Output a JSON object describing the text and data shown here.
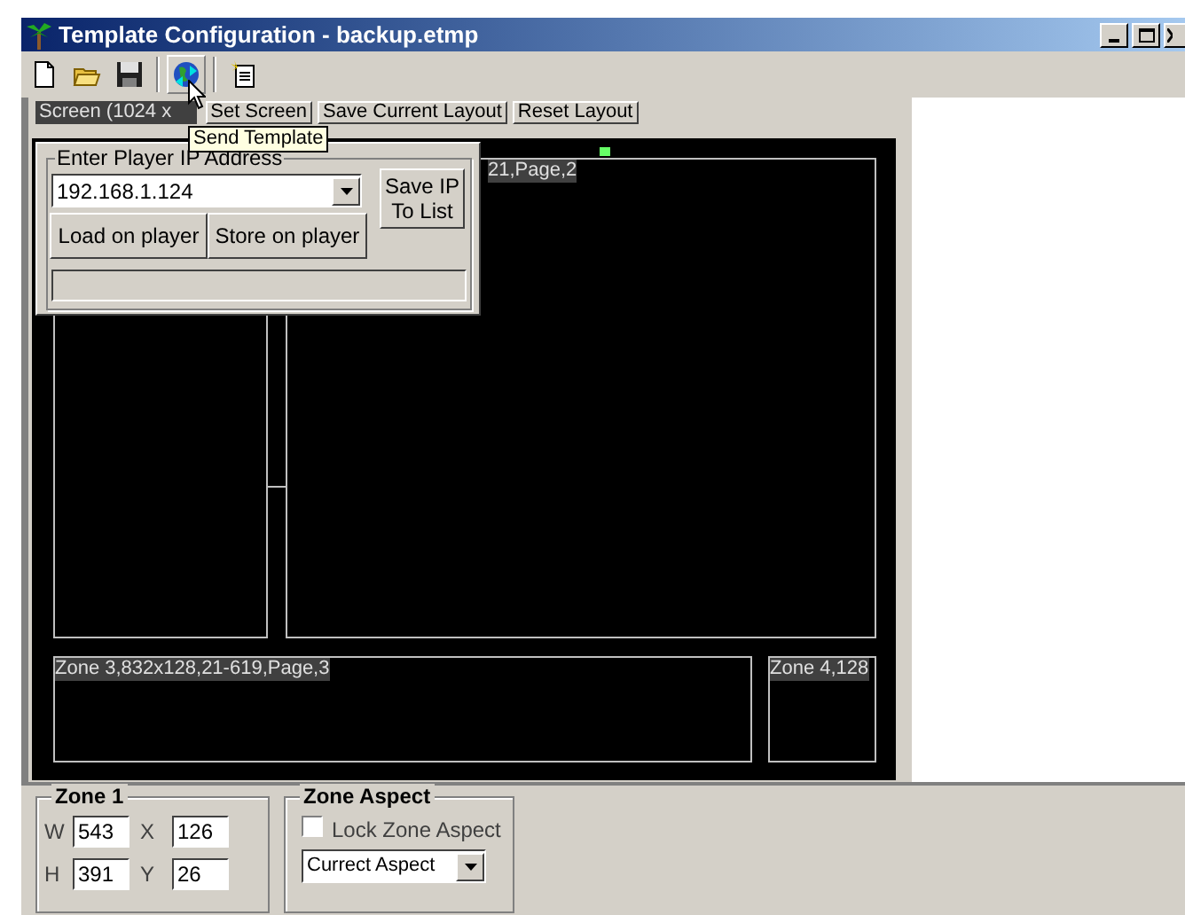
{
  "window": {
    "title": "Template Configuration - backup.etmp"
  },
  "toolbar": [
    {
      "kind": "new",
      "pressed": false
    },
    {
      "kind": "open",
      "pressed": false
    },
    {
      "kind": "save",
      "pressed": false
    },
    {
      "kind": "send",
      "pressed": true
    },
    {
      "kind": "export",
      "pressed": false
    }
  ],
  "tooltip": "Send Template",
  "screen_label": "Screen (1024 x",
  "layout_buttons": [
    "Set Screen",
    "Save Current Layout",
    "Reset Layout"
  ],
  "ip_panel": {
    "title": "Enter Player IP Address",
    "ip": "192.168.1.124",
    "buttons": [
      "Load on player",
      "Store on player"
    ],
    "save_button": [
      "Save IP",
      "To List"
    ]
  },
  "zones": [
    {
      "label": "21,Page,2"
    },
    {
      "label": "Zone 3,832x128,21-619,Page,3"
    },
    {
      "label": "Zone 4,128"
    }
  ],
  "zone_group": {
    "title": "Zone 1",
    "fields": [
      {
        "label": "W",
        "value": "543"
      },
      {
        "label": "X",
        "value": "126"
      },
      {
        "label": "H",
        "value": "391"
      },
      {
        "label": "Y",
        "value": "26"
      }
    ]
  },
  "aspect_group": {
    "title": "Zone Aspect",
    "lock": {
      "label": "Lock Zone Aspect",
      "checked": false
    },
    "select": "Currect Aspect"
  }
}
